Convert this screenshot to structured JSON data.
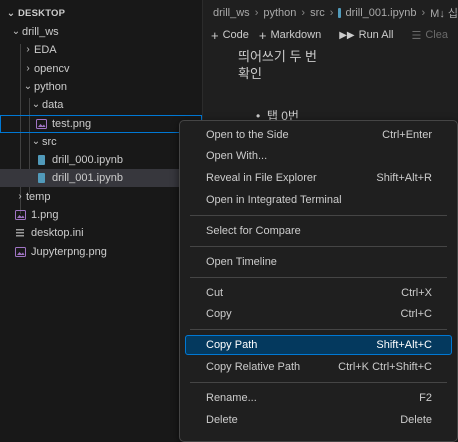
{
  "explorer": {
    "header": "DESKTOP",
    "items": [
      {
        "label": "drill_ws",
        "icon": "chevron-down-icon",
        "kind": "folder"
      },
      {
        "label": "EDA",
        "icon": "chevron-right-icon",
        "kind": "folder"
      },
      {
        "label": "opencv",
        "icon": "chevron-right-icon",
        "kind": "folder"
      },
      {
        "label": "python",
        "icon": "chevron-down-icon",
        "kind": "folder"
      },
      {
        "label": "data",
        "icon": "chevron-down-icon",
        "kind": "folder"
      },
      {
        "label": "test.png",
        "icon": "image-file-icon",
        "kind": "file"
      },
      {
        "label": "src",
        "icon": "chevron-down-icon",
        "kind": "folder"
      },
      {
        "label": "drill_000.ipynb",
        "icon": "notebook-file-icon",
        "kind": "file"
      },
      {
        "label": "drill_001.ipynb",
        "icon": "notebook-file-icon",
        "kind": "file"
      },
      {
        "label": "temp",
        "icon": "chevron-right-icon",
        "kind": "folder"
      },
      {
        "label": "1.png",
        "icon": "image-file-icon",
        "kind": "file"
      },
      {
        "label": "desktop.ini",
        "icon": "settings-file-icon",
        "kind": "file"
      },
      {
        "label": "Jupyterpng.png",
        "icon": "image-file-icon",
        "kind": "file"
      }
    ]
  },
  "breadcrumb": {
    "items": [
      "drill_ws",
      "python",
      "src",
      "drill_001.ipynb",
      "M↓ 십"
    ]
  },
  "toolbar": {
    "code": "Code",
    "markdown": "Markdown",
    "run_all": "Run All",
    "clear": "Clea"
  },
  "editor": {
    "line1": "띄어쓰기 두 번",
    "line2": "확인",
    "bullet": "탭 0번"
  },
  "context_menu": {
    "items": [
      {
        "label": "Open to the Side",
        "shortcut": "Ctrl+Enter"
      },
      {
        "label": "Open With...",
        "shortcut": ""
      },
      {
        "label": "Reveal in File Explorer",
        "shortcut": "Shift+Alt+R"
      },
      {
        "label": "Open in Integrated Terminal",
        "shortcut": ""
      },
      {
        "label": "Select for Compare",
        "shortcut": ""
      },
      {
        "label": "Open Timeline",
        "shortcut": ""
      },
      {
        "label": "Cut",
        "shortcut": "Ctrl+X"
      },
      {
        "label": "Copy",
        "shortcut": "Ctrl+C"
      },
      {
        "label": "Copy Path",
        "shortcut": "Shift+Alt+C"
      },
      {
        "label": "Copy Relative Path",
        "shortcut": "Ctrl+K Ctrl+Shift+C"
      },
      {
        "label": "Rename...",
        "shortcut": "F2"
      },
      {
        "label": "Delete",
        "shortcut": "Delete"
      }
    ],
    "highlighted": "Copy Path"
  },
  "colors": {
    "accent": "#0078d4",
    "menu_highlight": "#04395e",
    "selected_row": "#37373d",
    "notebook_icon": "#519aba",
    "image_icon": "#a074c4"
  }
}
